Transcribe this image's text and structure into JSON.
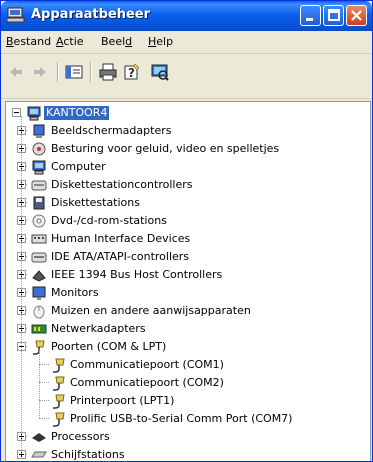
{
  "window": {
    "title": "Apparaatbeheer"
  },
  "menu": [
    {
      "label": "Bestand",
      "u": "B",
      "rest": "estand"
    },
    {
      "label": "Actie",
      "u": "A",
      "rest": "ctie"
    },
    {
      "label": "Beeld",
      "pre": "Beel",
      "u": "d",
      "rest": ""
    },
    {
      "label": "Help",
      "u": "H",
      "rest": "elp"
    }
  ],
  "toolbar": {
    "icons": [
      "back-arrow-icon",
      "forward-arrow-icon",
      "properties-icon",
      "print-icon",
      "help-icon",
      "scan-hardware-icon"
    ]
  },
  "tree": {
    "root": "KANTOOR4",
    "categories": [
      {
        "label": "Beeldschermadapters",
        "icon": "display-adapter-icon",
        "color": "#3B6FD6"
      },
      {
        "label": "Besturing voor geluid, video en spelletjes",
        "icon": "sound-icon",
        "color": "#7A7A7A"
      },
      {
        "label": "Computer",
        "icon": "computer-icon",
        "color": "#3B6FD6"
      },
      {
        "label": "Diskettestationcontrollers",
        "icon": "floppy-controller-icon",
        "color": "#8A8A8A"
      },
      {
        "label": "Diskettestations",
        "icon": "floppy-drive-icon",
        "color": "#4A5A8A"
      },
      {
        "label": "Dvd-/cd-rom-stations",
        "icon": "cdrom-icon",
        "color": "#9A9A9A"
      },
      {
        "label": "Human Interface Devices",
        "icon": "hid-icon",
        "color": "#6A6A6A"
      },
      {
        "label": "IDE ATA/ATAPI-controllers",
        "icon": "ide-controller-icon",
        "color": "#8A8A8A"
      },
      {
        "label": "IEEE 1394 Bus Host Controllers",
        "icon": "ieee1394-icon",
        "color": "#5A5A6A"
      },
      {
        "label": "Monitors",
        "icon": "monitor-icon",
        "color": "#3B6FD6"
      },
      {
        "label": "Muizen en andere aanwijsapparaten",
        "icon": "mouse-icon",
        "color": "#C8C8C8"
      },
      {
        "label": "Netwerkadapters",
        "icon": "network-adapter-icon",
        "color": "#2E8B2E"
      },
      {
        "label": "Poorten (COM & LPT)",
        "icon": "port-icon",
        "color": "#C8B040",
        "expanded": true,
        "children": [
          {
            "label": "Communicatiepoort (COM1)",
            "icon": "port-icon"
          },
          {
            "label": "Communicatiepoort (COM2)",
            "icon": "port-icon"
          },
          {
            "label": "Printerpoort (LPT1)",
            "icon": "port-icon"
          },
          {
            "label": "Prolific USB-to-Serial Comm Port (COM7)",
            "icon": "port-icon"
          }
        ]
      },
      {
        "label": "Processors",
        "icon": "processor-icon",
        "color": "#333333"
      },
      {
        "label": "Schijfstations",
        "icon": "disk-drive-icon",
        "color": "#8A8A8A"
      }
    ]
  },
  "colors": {
    "titlebar": "#0A5FEF",
    "selection": "#316AC5",
    "close": "#C9401E"
  }
}
